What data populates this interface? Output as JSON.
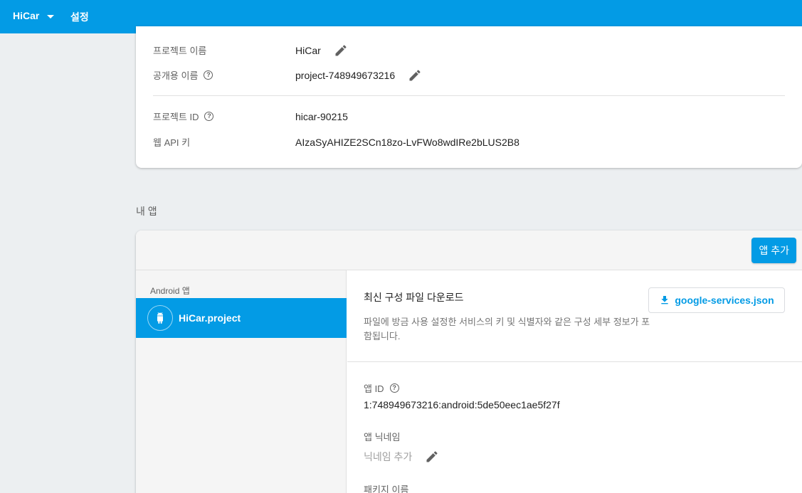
{
  "topbar": {
    "project_name": "HiCar",
    "settings_label": "설정"
  },
  "project": {
    "name_label": "프로젝트 이름",
    "name_value": "HiCar",
    "public_name_label": "공개용 이름",
    "public_name_value": "project-748949673216",
    "project_id_label": "프로젝트 ID",
    "project_id_value": "hicar-90215",
    "web_api_key_label": "웹 API 키",
    "web_api_key_value": "AIzaSyAHIZE2SCn18zo-LvFWo8wdIRe2bLUS2B8"
  },
  "my_apps": {
    "section_title": "내 앱",
    "add_app_label": "앱 추가",
    "platform_label": "Android 앱",
    "app_name": "HiCar.project",
    "download_title": "최신 구성 파일 다운로드",
    "download_desc": "파일에 방금 사용 설정한 서비스의 키 및 식별자와 같은 구성 세부 정보가 포함됩니다.",
    "json_button_label": "google-services.json",
    "app_id_label": "앱 ID",
    "app_id_value": "1:748949673216:android:5de50eec1ae5f27f",
    "nickname_label": "앱 닉네임",
    "nickname_placeholder": "닉네임 추가",
    "package_label": "패키지 이름"
  },
  "help_glyph": "?",
  "colors": {
    "primary": "#039be5",
    "background": "#eceff1"
  }
}
